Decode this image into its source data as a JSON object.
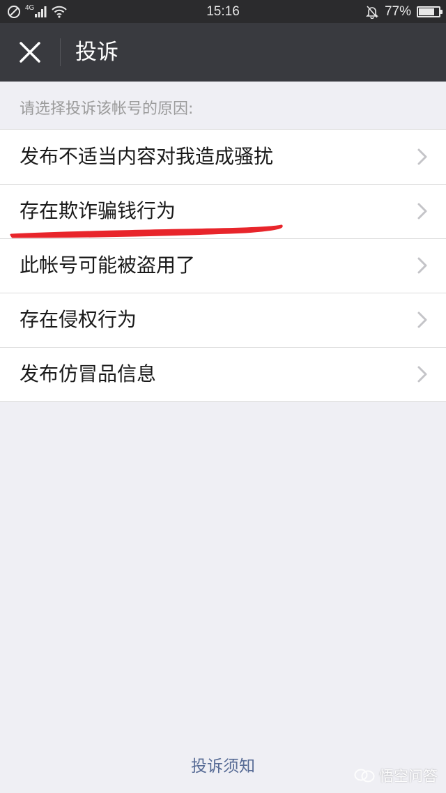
{
  "status_bar": {
    "time": "15:16",
    "battery_text": "77%",
    "battery_level": 0.77,
    "network_label": "4G",
    "icons": [
      "no-sim-icon",
      "signal-icon",
      "wifi-icon",
      "mute-bell-icon",
      "battery-icon"
    ]
  },
  "nav": {
    "title": "投诉",
    "close_icon": "close-icon"
  },
  "section_header": "请选择投诉该帐号的原因:",
  "reasons": [
    {
      "label": "发布不适当内容对我造成骚扰"
    },
    {
      "label": "存在欺诈骗钱行为"
    },
    {
      "label": "此帐号可能被盗用了"
    },
    {
      "label": "存在侵权行为"
    },
    {
      "label": "发布仿冒品信息"
    }
  ],
  "footer": {
    "link": "投诉须知"
  },
  "watermark": {
    "text": "悟空问答"
  },
  "colors": {
    "nav_bg": "#393a3f",
    "page_bg": "#efeff4",
    "link": "#576b95",
    "annotation": "#e8252b"
  }
}
